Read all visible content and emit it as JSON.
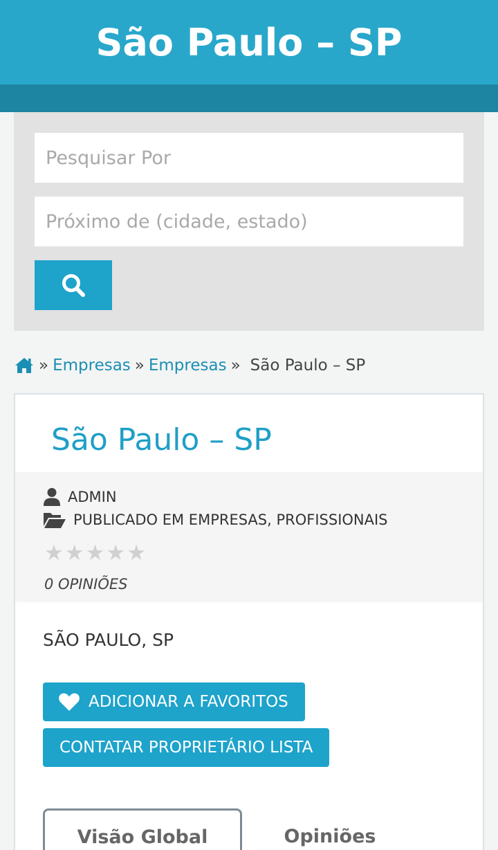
{
  "header": {
    "title": "São Paulo – SP"
  },
  "search": {
    "what_placeholder": "Pesquisar Por",
    "near_placeholder": "Próximo de (cidade, estado)"
  },
  "breadcrumb": {
    "sep": "»",
    "items": [
      "Empresas",
      "Empresas"
    ],
    "current": "São Paulo – SP"
  },
  "listing": {
    "title": "São Paulo – SP",
    "author": "ADMIN",
    "categories": "PUBLICADO EM EMPRESAS, PROFISSIONAIS",
    "rating": 0,
    "rating_max": 5,
    "reviews_count": "0 OPINIÕES",
    "location": "SÃO PAULO, SP",
    "favorite_label": "ADICIONAR A FAVORITOS",
    "contact_label": "CONTATAR PROPRIETÁRIO LISTA"
  },
  "tabs": [
    "Visão Global",
    "Opiniões"
  ],
  "colors": {
    "primary": "#29a7cb",
    "primary_dark": "#1d84a1",
    "button": "#1ea3cb",
    "link": "#1a8fb3"
  }
}
